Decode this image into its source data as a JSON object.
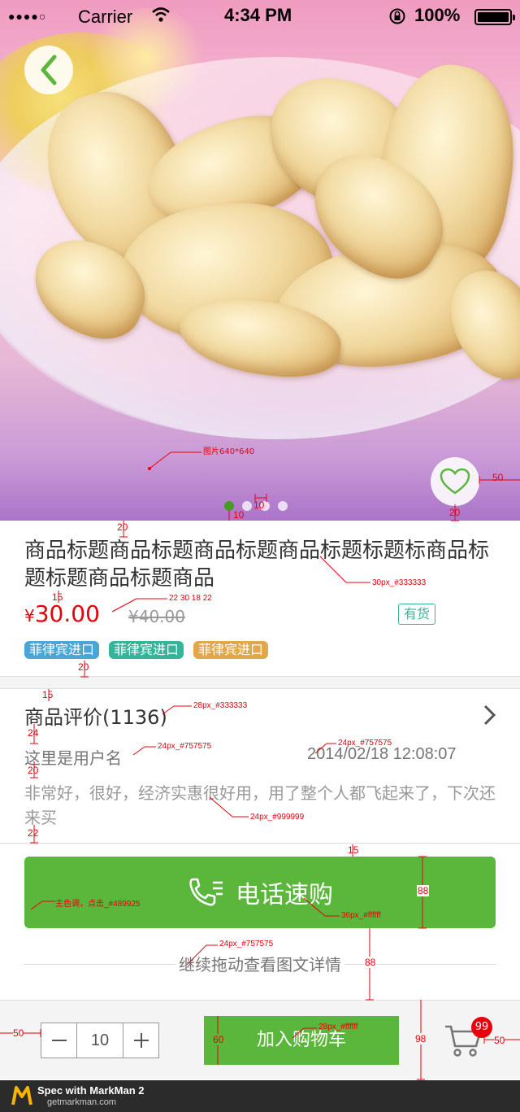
{
  "status_bar": {
    "signal": "●●●●○",
    "carrier": "Carrier",
    "time": "4:34 PM",
    "battery": "100%"
  },
  "product": {
    "image_label": "图片640*640",
    "title": "商品标题商品标题商品标题商品标题标题标商品标题标题商品标题商品",
    "price_symbol": "¥",
    "price": "30.00",
    "old_price": "¥40.00",
    "stock": "有货",
    "tags": [
      {
        "label": "菲律宾进口",
        "color": "#4aa6d6"
      },
      {
        "label": "菲律宾进口",
        "color": "#35b49a"
      },
      {
        "label": "菲律宾进口",
        "color": "#e0a84b"
      }
    ]
  },
  "reviews": {
    "title": "商品评价(1136)",
    "username": "这里是用户名",
    "date": "2014/02/18 12:08:07",
    "text": "非常好，很好，经济实惠很好用，用了整个人都飞起来了，下次还来买"
  },
  "call_button": {
    "label": "电话速购",
    "color": "#489925"
  },
  "drag_hint": "继续拖动查看图文详情",
  "bottom_bar": {
    "quantity": "10",
    "add_to_cart": "加入购物车",
    "cart_badge": "99"
  },
  "markman": {
    "line1": "Spec with MarkMan 2",
    "line2": "getmarkman.com"
  },
  "annotations": {
    "a_50_right": "50",
    "a_20_fav": "20",
    "a_10_dots_gap": "10",
    "a_10_dots_bottom": "10",
    "a_20_title_top": "20",
    "a_title_spec": "30px_#333333",
    "a_15_price": "15",
    "a_price_spec": "22 30 18 22",
    "a_20_tags": "20",
    "a_15_review_top": "15",
    "a_review_title_spec": "28px_#333333",
    "a_24_user_top": "24",
    "a_user_spec": "24px_#757575",
    "a_date_spec": "24px_#757575",
    "a_20_text_top": "20",
    "a_text_spec": "24px_#999999",
    "a_22_text_bottom": "22",
    "a_15_button_top": "15",
    "a_88_button_height": "88",
    "a_main_color": "主色调，点击_#489925",
    "a_button_text_spec": "36px_#ffffff",
    "a_hint_spec": "24px_#757575",
    "a_88_hint": "88",
    "a_50_left": "50",
    "a_60_cart_btn": "60",
    "a_cart_text_spec": "28px_#ffffff",
    "a_98_bar": "98",
    "a_50_cart_right": "50"
  }
}
